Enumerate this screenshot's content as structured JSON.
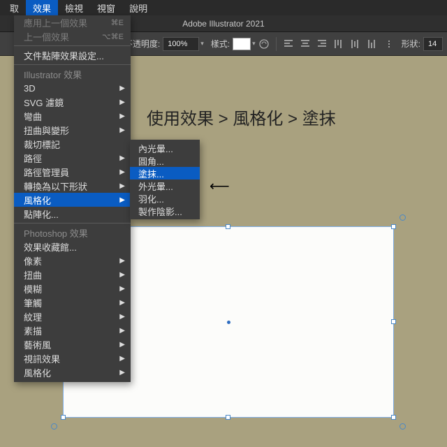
{
  "menubar": {
    "items": [
      "取",
      "效果",
      "檢視",
      "視窗",
      "說明"
    ],
    "selected": 1
  },
  "app": {
    "title": "Adobe Illustrator 2021"
  },
  "toolbar": {
    "opacity_label": "不透明度:",
    "opacity_value": "100%",
    "style_label": "樣式:",
    "shape_label": "形狀:",
    "trailing_value": "14"
  },
  "dropdown": {
    "recent": {
      "last_effect": {
        "label": "應用上一個效果",
        "shortcut": "⌘E"
      },
      "prev_effect": {
        "label": "上一個效果",
        "shortcut": "⌥⌘E"
      }
    },
    "raster_settings": "文件點陣效果設定...",
    "illustrator_header": "Illustrator 效果",
    "ai_items": [
      "3D",
      "SVG 濾鏡",
      "彎曲",
      "扭曲與變形",
      "裁切標記",
      "路徑",
      "路徑管理員",
      "轉換為以下形狀",
      "風格化",
      "點陣化..."
    ],
    "ai_selected_index": 8,
    "photoshop_header": "Photoshop 效果",
    "ps_items": [
      "效果收藏館...",
      "像素",
      "扭曲",
      "模糊",
      "筆觸",
      "紋理",
      "素描",
      "藝術風",
      "視訊效果",
      "風格化"
    ]
  },
  "submenu": {
    "items": [
      "內光暈...",
      "圓角...",
      "塗抹...",
      "外光暈...",
      "羽化...",
      "製作陰影..."
    ],
    "selected_index": 2
  },
  "instruction": "使用效果 > 風格化 > 塗抹",
  "arrow_glyph": "⟵"
}
